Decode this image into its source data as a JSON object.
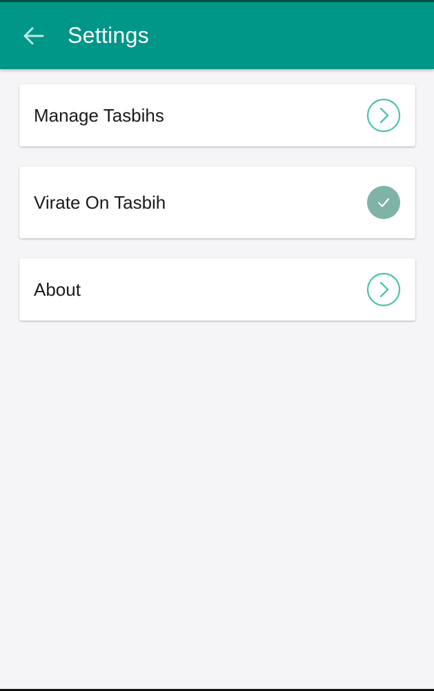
{
  "header": {
    "title": "Settings",
    "back_icon": "arrow-left-icon"
  },
  "settings": {
    "items": [
      {
        "label": "Manage Tasbihs",
        "icon": "chevron-right-circle-icon"
      },
      {
        "label": "Virate On Tasbih",
        "icon": "check-circle-icon",
        "checked": true
      },
      {
        "label": "About",
        "icon": "chevron-right-circle-icon"
      }
    ]
  },
  "colors": {
    "app_bar": "#009688",
    "accent_outline": "#4fc3ab",
    "check_fill": "#7fb3a8",
    "background": "#f5f4f6"
  }
}
